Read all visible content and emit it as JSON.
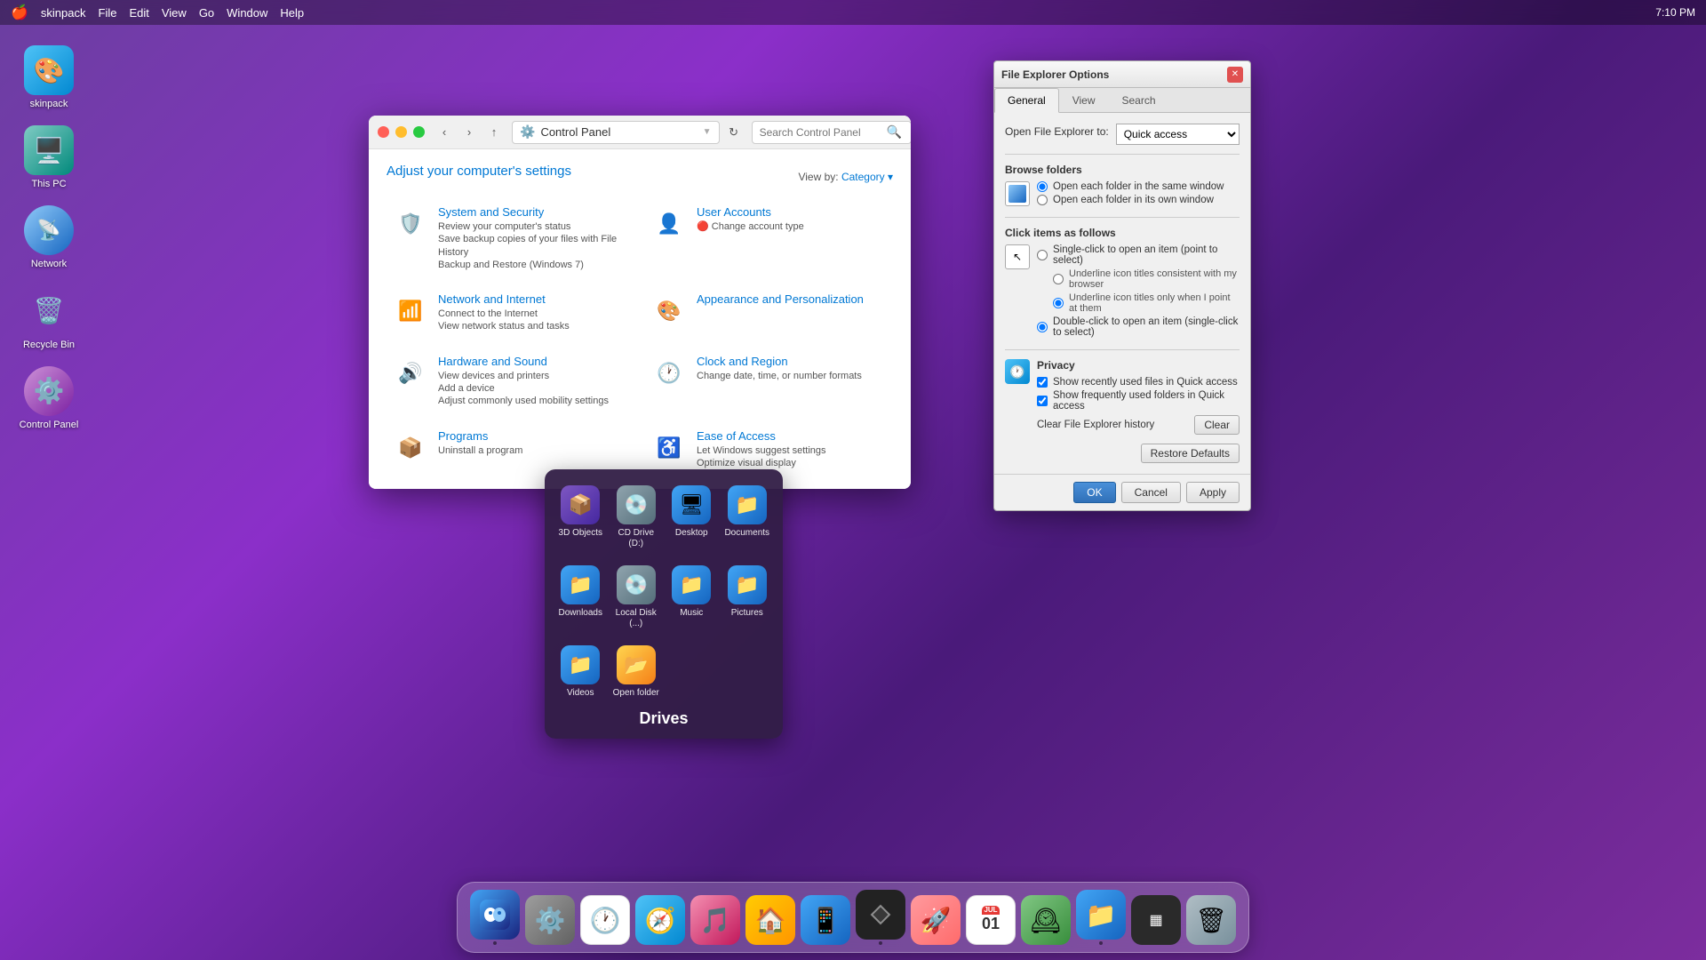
{
  "menubar": {
    "apple": "🍎",
    "time": "7:10 PM",
    "items": [
      "skinpack",
      "File",
      "Edit",
      "View",
      "Go",
      "Window",
      "Help"
    ]
  },
  "desktop_icons": [
    {
      "id": "skinpack",
      "label": "skinpack",
      "emoji": "🎨",
      "class": "icon-skinpack"
    },
    {
      "id": "thispc",
      "label": "This PC",
      "emoji": "🖥️",
      "class": "icon-thispc"
    },
    {
      "id": "network",
      "label": "Network",
      "emoji": "📡",
      "class": "icon-network"
    },
    {
      "id": "recyclebin",
      "label": "Recycle Bin",
      "emoji": "🗑️",
      "class": "icon-recyclebin"
    },
    {
      "id": "controlpanel",
      "label": "Control Panel",
      "emoji": "⚙️",
      "class": "icon-controlpanel"
    }
  ],
  "control_panel": {
    "title": "Control Panel",
    "search_placeholder": "Search Control Panel",
    "heading": "Adjust your computer's settings",
    "view_by": "View by:",
    "view_mode": "Category",
    "items": [
      {
        "id": "system-security",
        "title": "System and Security",
        "desc": "Review your computer's status\nSave backup copies of your files with File History\nBackup and Restore (Windows 7)",
        "emoji": "🛡️"
      },
      {
        "id": "user-accounts",
        "title": "User Accounts",
        "desc": "🔴 Change account type",
        "emoji": "👤"
      },
      {
        "id": "network-internet",
        "title": "Network and Internet",
        "desc": "Connect to the Internet\nView network status and tasks",
        "emoji": "📶"
      },
      {
        "id": "appearance",
        "title": "Appearance and Personalization",
        "desc": "",
        "emoji": "🎨"
      },
      {
        "id": "hardware-sound",
        "title": "Hardware and Sound",
        "desc": "View devices and printers\nAdd a device\nAdjust commonly used mobility settings",
        "emoji": "🔊"
      },
      {
        "id": "clock-region",
        "title": "Clock and Region",
        "desc": "Change date, time, or number formats",
        "emoji": "🕐"
      },
      {
        "id": "programs",
        "title": "Programs",
        "desc": "Uninstall a program",
        "emoji": "📦"
      },
      {
        "id": "ease-access",
        "title": "Ease of Access",
        "desc": "Let Windows suggest settings\nOptimize visual display",
        "emoji": "♿"
      }
    ]
  },
  "file_explorer_options": {
    "title": "File Explorer Options",
    "tabs": [
      "General",
      "View",
      "Search"
    ],
    "active_tab": "General",
    "open_to_label": "Open File Explorer to:",
    "open_to_value": "Quick access",
    "browse_folders_label": "Browse folders",
    "option_same_window": "Open each folder in the same window",
    "option_own_window": "Open each folder in its own window",
    "click_items_label": "Click items as follows",
    "option_single_click": "Single-click to open an item (point to select)",
    "option_underline_consistent": "Underline icon titles consistent with my browser",
    "option_underline_hover": "Underline icon titles only when I point at them",
    "option_double_click": "Double-click to open an item (single-click to select)",
    "privacy_label": "Privacy",
    "check_recent_files": "Show recently used files in Quick access",
    "check_frequent_folders": "Show frequently used folders in Quick access",
    "clear_history_label": "Clear File Explorer history",
    "clear_btn": "Clear",
    "restore_defaults_btn": "Restore Defaults",
    "ok_btn": "OK",
    "cancel_btn": "Cancel",
    "apply_btn": "Apply"
  },
  "drives_popup": {
    "title": "Drives",
    "items": [
      {
        "id": "3d-objects",
        "label": "3D Objects",
        "emoji": "📦",
        "class": "icon-3d"
      },
      {
        "id": "cd-drive",
        "label": "CD Drive (D:)",
        "emoji": "💿",
        "class": "icon-cd"
      },
      {
        "id": "desktop",
        "label": "Desktop",
        "emoji": "🖥",
        "class": "icon-desktop"
      },
      {
        "id": "documents",
        "label": "Documents",
        "emoji": "📁",
        "class": "icon-documents"
      },
      {
        "id": "downloads",
        "label": "Downloads",
        "emoji": "📁",
        "class": "icon-downloads"
      },
      {
        "id": "local-disk",
        "label": "Local Disk (...)",
        "emoji": "💿",
        "class": "icon-localdisk"
      },
      {
        "id": "music",
        "label": "Music",
        "emoji": "📁",
        "class": "icon-music"
      },
      {
        "id": "pictures",
        "label": "Pictures",
        "emoji": "📁",
        "class": "icon-pictures"
      },
      {
        "id": "videos",
        "label": "Videos",
        "emoji": "📁",
        "class": "icon-videos"
      },
      {
        "id": "open-folder",
        "label": "Open folder",
        "emoji": "📂",
        "class": "icon-openfolder"
      }
    ]
  },
  "dock": {
    "items": [
      {
        "id": "finder",
        "emoji": "😊",
        "class": "dock-finder",
        "dot": true
      },
      {
        "id": "settings",
        "emoji": "⚙️",
        "class": "dock-settings",
        "dot": false
      },
      {
        "id": "clock",
        "emoji": "🕐",
        "class": "dock-clock",
        "dot": false
      },
      {
        "id": "safari",
        "emoji": "🧭",
        "class": "dock-safari",
        "dot": false
      },
      {
        "id": "itunes",
        "emoji": "🎵",
        "class": "dock-itunes",
        "dot": false
      },
      {
        "id": "home",
        "emoji": "🏠",
        "class": "dock-home",
        "dot": false
      },
      {
        "id": "appstore",
        "emoji": "🅰",
        "class": "dock-appstore",
        "dot": false
      },
      {
        "id": "bootcamp",
        "emoji": "⬡",
        "class": "dock-bootcamp",
        "dot": true
      },
      {
        "id": "launchpad",
        "emoji": "⬛",
        "class": "dock-launchpad",
        "dot": false
      },
      {
        "id": "calendar",
        "emoji": "📅",
        "class": "dock-calendar",
        "dot": false
      },
      {
        "id": "timemachine",
        "emoji": "🕰",
        "class": "dock-timemachine",
        "dot": false
      },
      {
        "id": "finder2",
        "emoji": "📁",
        "class": "dock-finder2",
        "dot": true
      },
      {
        "id": "missionctrl",
        "emoji": "▦",
        "class": "dock-missionctrl",
        "dot": false
      },
      {
        "id": "trash",
        "emoji": "🗑",
        "class": "dock-trash",
        "dot": false
      }
    ]
  }
}
